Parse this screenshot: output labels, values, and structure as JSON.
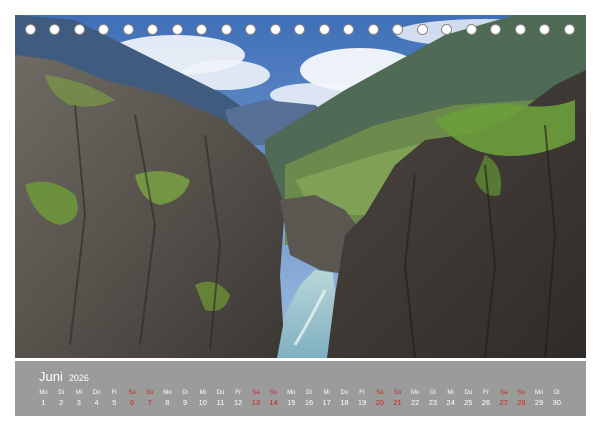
{
  "calendar": {
    "month": "Juni",
    "year": "2026",
    "days": [
      {
        "dow": "Mo",
        "num": "1",
        "weekend": false
      },
      {
        "dow": "Di",
        "num": "2",
        "weekend": false
      },
      {
        "dow": "Mi",
        "num": "3",
        "weekend": false
      },
      {
        "dow": "Do",
        "num": "4",
        "weekend": false
      },
      {
        "dow": "Fr",
        "num": "5",
        "weekend": false
      },
      {
        "dow": "Sa",
        "num": "6",
        "weekend": true
      },
      {
        "dow": "So",
        "num": "7",
        "weekend": true
      },
      {
        "dow": "Mo",
        "num": "8",
        "weekend": false
      },
      {
        "dow": "Di",
        "num": "9",
        "weekend": false
      },
      {
        "dow": "Mi",
        "num": "10",
        "weekend": false
      },
      {
        "dow": "Do",
        "num": "11",
        "weekend": false
      },
      {
        "dow": "Fr",
        "num": "12",
        "weekend": false
      },
      {
        "dow": "Sa",
        "num": "13",
        "weekend": true
      },
      {
        "dow": "So",
        "num": "14",
        "weekend": true
      },
      {
        "dow": "Mo",
        "num": "15",
        "weekend": false
      },
      {
        "dow": "Di",
        "num": "16",
        "weekend": false
      },
      {
        "dow": "Mi",
        "num": "17",
        "weekend": false
      },
      {
        "dow": "Do",
        "num": "18",
        "weekend": false
      },
      {
        "dow": "Fr",
        "num": "19",
        "weekend": false
      },
      {
        "dow": "Sa",
        "num": "20",
        "weekend": true
      },
      {
        "dow": "So",
        "num": "21",
        "weekend": true
      },
      {
        "dow": "Mo",
        "num": "22",
        "weekend": false
      },
      {
        "dow": "Di",
        "num": "23",
        "weekend": false
      },
      {
        "dow": "Mi",
        "num": "24",
        "weekend": false
      },
      {
        "dow": "Do",
        "num": "25",
        "weekend": false
      },
      {
        "dow": "Fr",
        "num": "26",
        "weekend": false
      },
      {
        "dow": "Sa",
        "num": "27",
        "weekend": true
      },
      {
        "dow": "So",
        "num": "28",
        "weekend": true
      },
      {
        "dow": "Mo",
        "num": "29",
        "weekend": false
      },
      {
        "dow": "Di",
        "num": "30",
        "weekend": false
      }
    ]
  },
  "colors": {
    "calendar_band": "#9b9b9b",
    "weekday_text": "#ffffff",
    "weekend_text": "#c9281c"
  }
}
